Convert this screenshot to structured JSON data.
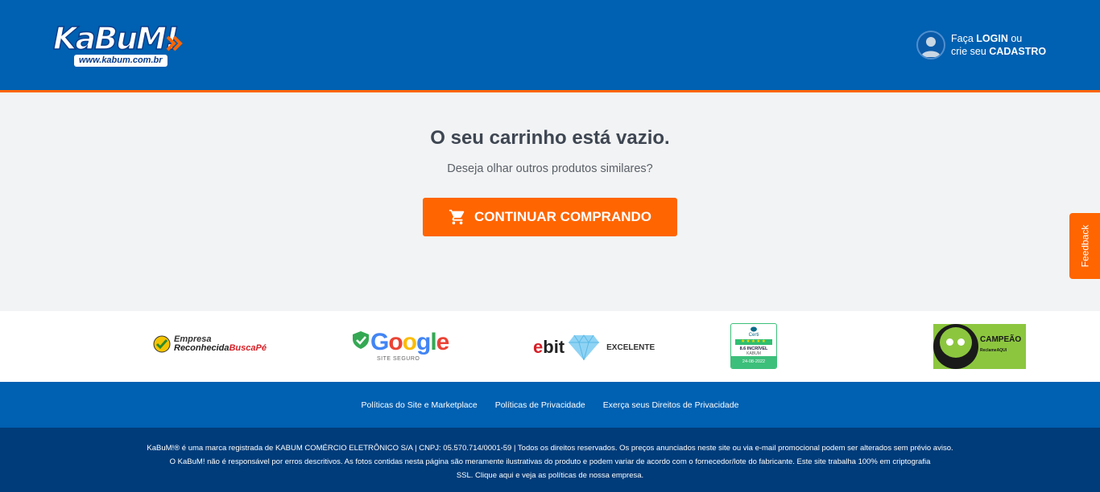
{
  "header": {
    "logo": {
      "brand": "KaBuM!",
      "url": "www.kabum.com.br"
    },
    "login": {
      "line1_prefix": "Faça",
      "line1_bold": "LOGIN",
      "line1_suffix": "ou",
      "line2_prefix": "crie seu",
      "line2_bold": "CADASTRO"
    }
  },
  "main": {
    "title": "O seu carrinho está vazio.",
    "subtitle": "Deseja olhar outros produtos similares?",
    "button_label": "CONTINUAR COMPRANDO"
  },
  "feedback_tab": {
    "label": "Feedback"
  },
  "seals": {
    "buscape": {
      "line1": "Empresa",
      "line2a": "Reconhecida",
      "line2b": "BuscaPé"
    },
    "google": {
      "word": "Google",
      "sub": "SITE SEGURO"
    },
    "ebit": {
      "e": "e",
      "rest": "bit",
      "level": "EXCELENTE"
    },
    "cert": {
      "brand": "Certi",
      "stars": "★★★★★",
      "score": "8.6 INCRÍVEL",
      "name": "KABUM",
      "date": "24-08-2022"
    },
    "reclame_aqui": {
      "label": "CAMPEÃO",
      "small": "ReclameAQUI"
    }
  },
  "footer": {
    "links": [
      "Políticas do Site e Marketplace",
      "Políticas de Privacidade",
      "Exerça seus Direitos de Privacidade"
    ],
    "legal": {
      "line1": "KaBuM!® é uma marca registrada de KABUM COMÉRCIO ELETRÔNICO S/A | CNPJ: 05.570.714/0001-59 | Todos os direitos reservados. Os preços anunciados neste site ou via e-mail promocional podem ser alterados sem prévio aviso.",
      "line2": "O KaBuM! não é responsável por erros descritivos. As fotos contidas nesta página são meramente ilustrativas do produto e podem variar de acordo com o fornecedor/lote do fabricante. Este site trabalha 100% em criptografia",
      "line3": "SSL. Clique aqui e veja as políticas de nossa empresa."
    }
  },
  "colors": {
    "primary_blue": "#0060b1",
    "dark_blue": "#003c7a",
    "accent_orange": "#ff6500"
  }
}
